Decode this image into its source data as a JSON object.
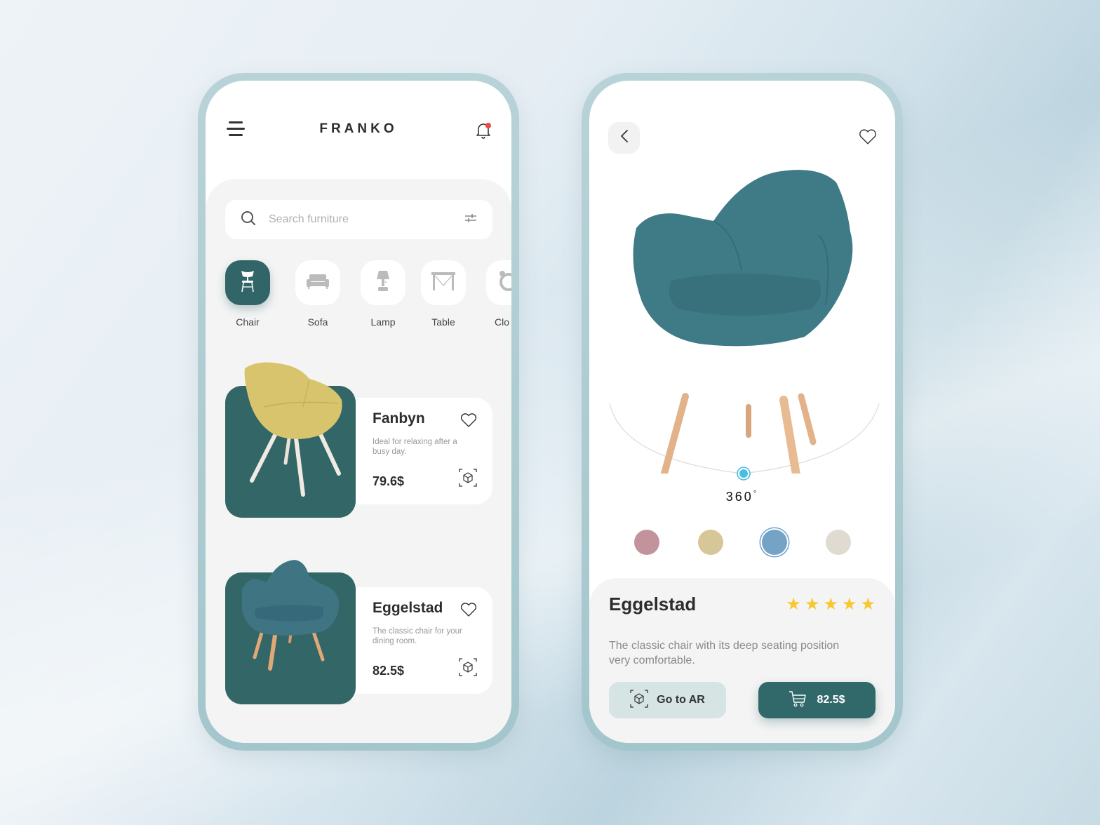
{
  "left_screen": {
    "header": {
      "menu_icon": "hamburger-menu-icon",
      "brand": "FRANKO",
      "notification_icon": "bell-icon",
      "has_notification": true
    },
    "search": {
      "placeholder": "Search furniture",
      "value": "",
      "search_icon": "search-icon",
      "filter_icon": "sliders-icon"
    },
    "categories": [
      {
        "label": "Chair",
        "icon": "chair-icon",
        "active": true
      },
      {
        "label": "Sofa",
        "icon": "sofa-icon",
        "active": false
      },
      {
        "label": "Lamp",
        "icon": "lamp-icon",
        "active": false
      },
      {
        "label": "Table",
        "icon": "table-icon",
        "active": false
      },
      {
        "label": "Clo",
        "icon": "clock-icon",
        "active": false
      }
    ],
    "products": [
      {
        "name": "Fanbyn",
        "description": "Ideal for relaxing after a busy day.",
        "price": "79.6$",
        "chair_color": "#d9c46e"
      },
      {
        "name": "Eggelstad",
        "description": "The classic chair for your dining room.",
        "price": "82.5$",
        "chair_color": "#3f7583"
      }
    ]
  },
  "right_screen": {
    "back_icon": "chevron-left-icon",
    "favorite_icon": "heart-icon",
    "rotation_label": "360",
    "rotation_unit": "°",
    "colors": [
      {
        "hex": "#c3939c",
        "selected": false
      },
      {
        "hex": "#d6c698",
        "selected": false
      },
      {
        "hex": "#74a3c6",
        "selected": true
      },
      {
        "hex": "#e0dbd1",
        "selected": false
      }
    ],
    "product": {
      "name": "Eggelstad",
      "rating": 5,
      "rating_max": 5,
      "description": "The classic chair with its deep seating position very comfortable.",
      "ar_button_label": "Go to AR",
      "price_button_label": "82.5$"
    }
  },
  "theme": {
    "primary": "#336667",
    "accent_blue": "#4bbde3",
    "star": "#f8c830",
    "notification": "#f04848"
  }
}
